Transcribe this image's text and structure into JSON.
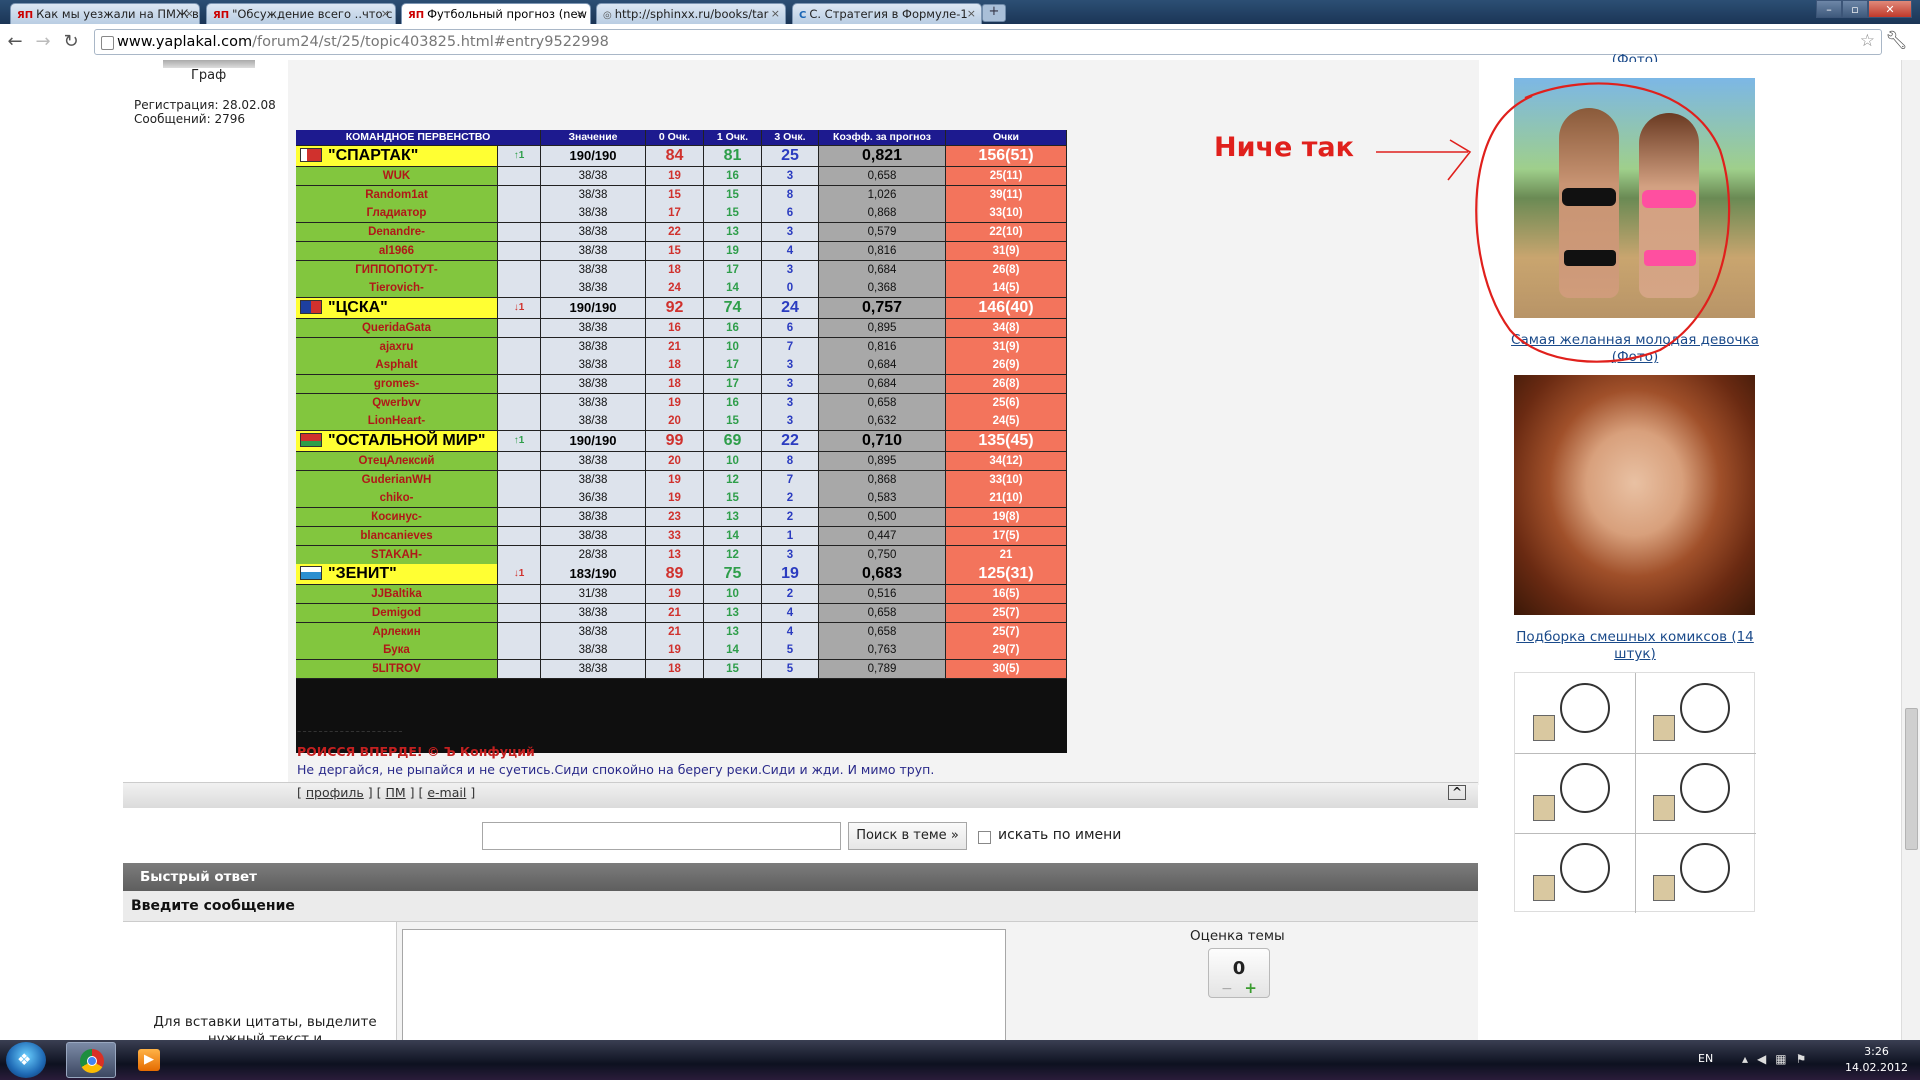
{
  "browser": {
    "tabs": [
      {
        "favicon": "ЯП",
        "label": "Как мы уезжали на ПМЖ в"
      },
      {
        "favicon": "ЯП",
        "label": "\"Обсуждение всего ..что с"
      },
      {
        "favicon": "ЯП",
        "label": "Футбольный прогноз (new"
      },
      {
        "favicon": "globe-icon",
        "label": "http://sphinxx.ru/books/tar"
      },
      {
        "favicon": "C",
        "label": "С. Стратегия в Формуле-1"
      }
    ],
    "active_tab_index": 2,
    "url_host": "www.yaplakal.com",
    "url_path": "/forum24/st/25/topic403825.html#entry9522998"
  },
  "user": {
    "name": "Граф",
    "registration": "Регистрация: 28.02.08",
    "posts": "Сообщений: 2796"
  },
  "table": {
    "headers": [
      "КОМАНДНОЕ ПЕРВЕНСТВО",
      "Значение",
      "0 Очк.",
      "1 Очк.",
      "3 Очк.",
      "Коэфф. за прогноз",
      "Очки"
    ],
    "teams": [
      {
        "name": "\"СПАРТАК\"",
        "flag": "spartak",
        "trend": "↑1",
        "trend_color": "#2e9e4a",
        "value": "190/190",
        "p0": "84",
        "p1": "81",
        "p3": "25",
        "coef": "0,821",
        "points": "156(51)",
        "players": [
          [
            "WUK",
            "38/38",
            "19",
            "16",
            "3",
            "0,658",
            "25(11)"
          ],
          [
            "Random1at",
            "38/38",
            "15",
            "15",
            "8",
            "1,026",
            "39(11)"
          ],
          [
            "Гладиатор",
            "38/38",
            "17",
            "15",
            "6",
            "0,868",
            "33(10)"
          ],
          [
            "Denandre-",
            "38/38",
            "22",
            "13",
            "3",
            "0,579",
            "22(10)"
          ],
          [
            "al1966",
            "38/38",
            "15",
            "19",
            "4",
            "0,816",
            "31(9)"
          ],
          [
            "ГИППОПОТУТ-",
            "38/38",
            "18",
            "17",
            "3",
            "0,684",
            "26(8)"
          ],
          [
            "Tierovich-",
            "38/38",
            "24",
            "14",
            "0",
            "0,368",
            "14(5)"
          ]
        ]
      },
      {
        "name": "\"ЦСКА\"",
        "flag": "cska",
        "trend": "↓1",
        "trend_color": "#d0312d",
        "value": "190/190",
        "p0": "92",
        "p1": "74",
        "p3": "24",
        "coef": "0,757",
        "points": "146(40)",
        "players": [
          [
            "QueridaGata",
            "38/38",
            "16",
            "16",
            "6",
            "0,895",
            "34(8)"
          ],
          [
            "ajaxru",
            "38/38",
            "21",
            "10",
            "7",
            "0,816",
            "31(9)"
          ],
          [
            "Asphalt",
            "38/38",
            "18",
            "17",
            "3",
            "0,684",
            "26(9)"
          ],
          [
            "gromes-",
            "38/38",
            "18",
            "17",
            "3",
            "0,684",
            "26(8)"
          ],
          [
            "Qwerbvv",
            "38/38",
            "19",
            "16",
            "3",
            "0,658",
            "25(6)"
          ],
          [
            "LionHeart-",
            "38/38",
            "20",
            "15",
            "3",
            "0,632",
            "24(5)"
          ]
        ]
      },
      {
        "name": "\"ОСТАЛЬНОЙ МИР\"",
        "flag": "world",
        "trend": "↑1",
        "trend_color": "#2e9e4a",
        "value": "190/190",
        "p0": "99",
        "p1": "69",
        "p3": "22",
        "coef": "0,710",
        "points": "135(45)",
        "players": [
          [
            "ОтецАлексий",
            "38/38",
            "20",
            "10",
            "8",
            "0,895",
            "34(12)"
          ],
          [
            "GuderianWH",
            "38/38",
            "19",
            "12",
            "7",
            "0,868",
            "33(10)"
          ],
          [
            "chiko-",
            "36/38",
            "19",
            "15",
            "2",
            "0,583",
            "21(10)"
          ],
          [
            "Косинус-",
            "38/38",
            "23",
            "13",
            "2",
            "0,500",
            "19(8)"
          ],
          [
            "blancanieves",
            "38/38",
            "33",
            "14",
            "1",
            "0,447",
            "17(5)"
          ],
          [
            "STAKAH-",
            "28/38",
            "13",
            "12",
            "3",
            "0,750",
            "21"
          ]
        ]
      },
      {
        "name": "\"ЗЕНИТ\"",
        "flag": "zenit",
        "trend": "↓1",
        "trend_color": "#d0312d",
        "value": "183/190",
        "p0": "89",
        "p1": "75",
        "p3": "19",
        "coef": "0,683",
        "points": "125(31)",
        "players": [
          [
            "JJBaltika",
            "31/38",
            "19",
            "10",
            "2",
            "0,516",
            "16(5)"
          ],
          [
            "Demigod",
            "38/38",
            "21",
            "13",
            "4",
            "0,658",
            "25(7)"
          ],
          [
            "Арлекин",
            "38/38",
            "21",
            "13",
            "4",
            "0,658",
            "25(7)"
          ],
          [
            "Бука",
            "38/38",
            "19",
            "14",
            "5",
            "0,763",
            "29(7)"
          ],
          [
            "5LITROV",
            "38/38",
            "18",
            "15",
            "5",
            "0,789",
            "30(5)"
          ]
        ]
      }
    ]
  },
  "signature": {
    "line": "--------------------",
    "quote1": "РОИССЯ ВПЕРДЕ! © Ъ Конфуций",
    "quote2": "Не дергайся, не рыпайся и не суетись.Сиди спокойно на берегу реки.Сиди и жди. И мимо труп."
  },
  "post_links": {
    "profile": "профиль",
    "pm": "ПМ",
    "email": "e-mail",
    "top": "^"
  },
  "search": {
    "button": "Поиск в теме »",
    "checkbox_label": "искать по имени",
    "value": ""
  },
  "quick_reply": {
    "header": "Быстрый ответ",
    "subheader": "Введите сообщение",
    "hint": "Для вставки цитаты, выделите нужный текст и",
    "rating_label": "Оценка темы",
    "rating_value": "0",
    "minus": "−",
    "plus": "+"
  },
  "sidebar": {
    "top_caption": "(Фото)",
    "item1_caption": "Самая желанная молодая девочка (Фото)",
    "item2_caption": "Подборка смешных комиксов (14 штук)"
  },
  "annotation": {
    "text": "Ниче так",
    "color": "#e0201c"
  },
  "taskbar": {
    "lang": "EN",
    "time": "3:26",
    "date": "14.02.2012"
  }
}
